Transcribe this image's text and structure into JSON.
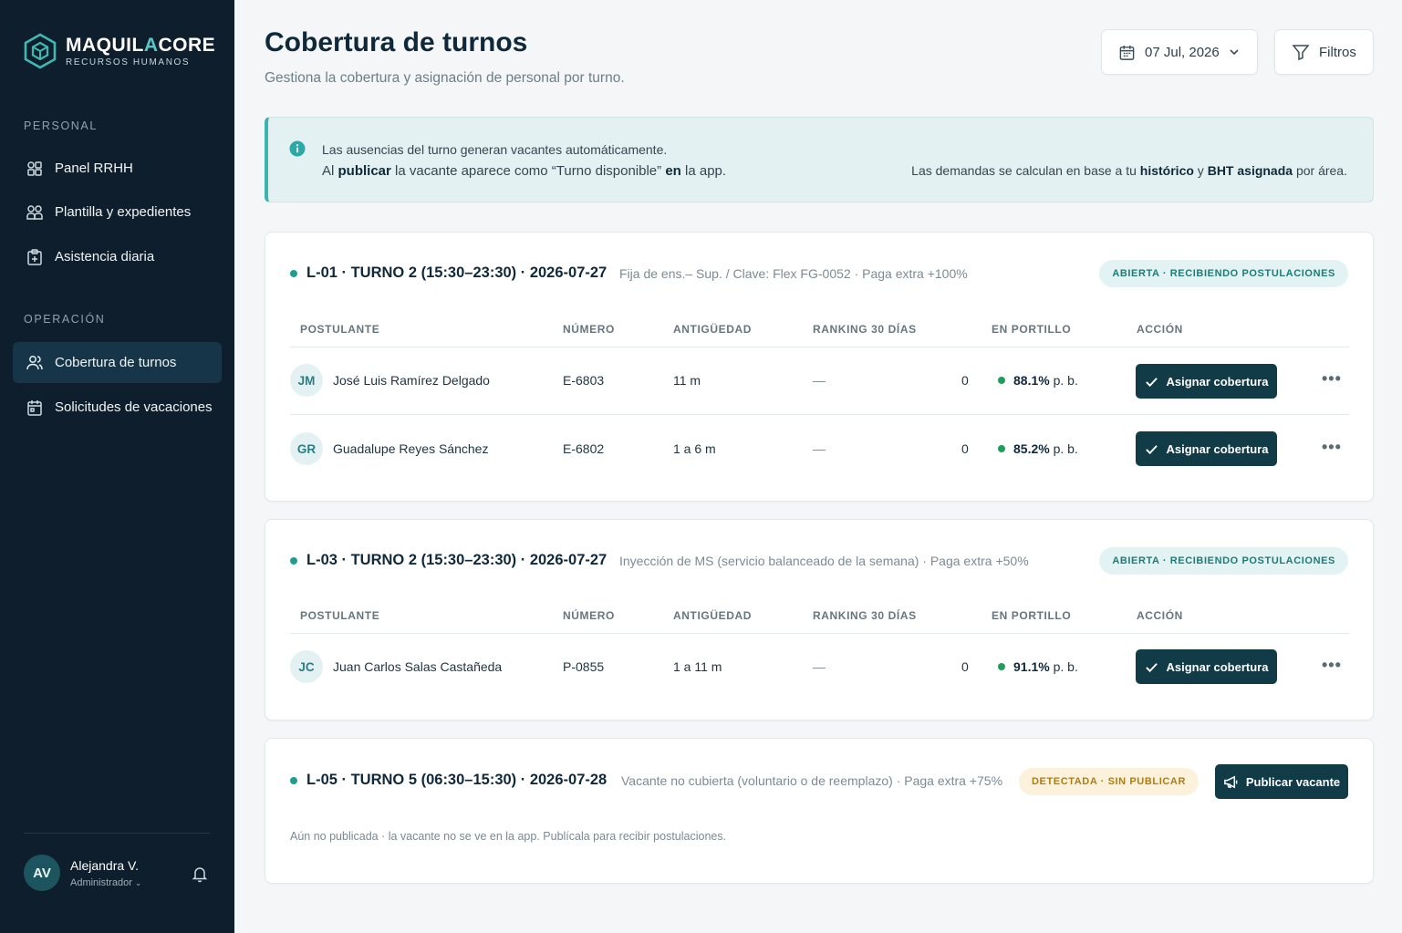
{
  "brand": {
    "name_part1": "MAQUIL",
    "name_accent": "A",
    "name_part2": "CORE",
    "subtitle": "RECURSOS HUMANOS"
  },
  "sidebar": {
    "sections": [
      {
        "title": "PERSONAL",
        "items": [
          {
            "label": "Panel RRHH",
            "icon": "dashboard-icon"
          },
          {
            "label": "Plantilla y expedientes",
            "icon": "users-grid-icon"
          },
          {
            "label": "Asistencia diaria",
            "icon": "clipboard-icon"
          }
        ]
      },
      {
        "title": "OPERACIÓN",
        "items": [
          {
            "label": "Cobertura de turnos",
            "icon": "users-icon",
            "active": true
          },
          {
            "label": "Solicitudes de vacaciones",
            "icon": "calendar-icon"
          }
        ]
      }
    ],
    "user": {
      "initials": "AV",
      "name": "Alejandra V.",
      "role": "Administrador"
    }
  },
  "header": {
    "title": "Cobertura de turnos",
    "subtitle": "Gestiona la cobertura y asignación de personal por turno.",
    "date": "07 Jul, 2026",
    "filters": "Filtros"
  },
  "banner": {
    "line1": "Las ausencias del turno generan vacantes automáticamente.",
    "l2_a": "Al ",
    "l2_b": "publicar",
    "l2_c": " la vacante aparece como “Turno disponible” ",
    "l2_d": "en",
    "l2_e": " la app.",
    "r_a": "Las demandas se calculan en base a tu ",
    "r_b": "histórico",
    "r_c": " y ",
    "r_d": "BHT asignada",
    "r_e": " por área."
  },
  "columns": [
    "POSTULANTE",
    "NÚMERO",
    "ANTIGÜEDAD",
    "RANKING 30 DÍAS",
    "EN PORTILLO",
    "ACCIÓN"
  ],
  "assign_label": "Asignar cobertura",
  "more_label": "•••",
  "shifts": [
    {
      "title": "L-01 · TURNO 2 (15:30–23:30) · 2026-07-27",
      "desc": "Fija de ens.– Sup. / Clave: Flex FG-0052 · Paga extra +100%",
      "status": "ABIERTA · RECIBIENDO POSTULACIONES",
      "rows": [
        {
          "initials": "JM",
          "name": "José Luis Ramírez Delgado",
          "number": "E-6803",
          "seniority": "11 m",
          "ranking": "—",
          "count": "0",
          "pct": "88.1%",
          "pct_unit": " p. b."
        },
        {
          "initials": "GR",
          "name": "Guadalupe Reyes Sánchez",
          "number": "E-6802",
          "seniority": "1 a 6 m",
          "ranking": "—",
          "count": "0",
          "pct": "85.2%",
          "pct_unit": " p. b."
        }
      ]
    },
    {
      "title": "L-03 · TURNO 2 (15:30–23:30) · 2026-07-27",
      "desc": "Inyección de MS (servicio balanceado de la semana) · Paga extra +50%",
      "status": "ABIERTA · RECIBIENDO POSTULACIONES",
      "rows": [
        {
          "initials": "JC",
          "name": "Juan Carlos Salas Castañeda",
          "number": "P-0855",
          "seniority": "1 a 11 m",
          "ranking": "—",
          "count": "0",
          "pct": "91.1%",
          "pct_unit": " p. b."
        }
      ]
    },
    {
      "title": "L-05 · TURNO 5 (06:30–15:30) · 2026-07-28",
      "desc": "Vacante no cubierta (voluntario o de reemplazo) · Paga extra +75%",
      "status": "DETECTADA · SIN PUBLICAR",
      "publish_label": "Publicar vacante",
      "note": "Aún no publicada · la vacante no se ve en la app. Publícala para recibir postulaciones."
    }
  ]
}
